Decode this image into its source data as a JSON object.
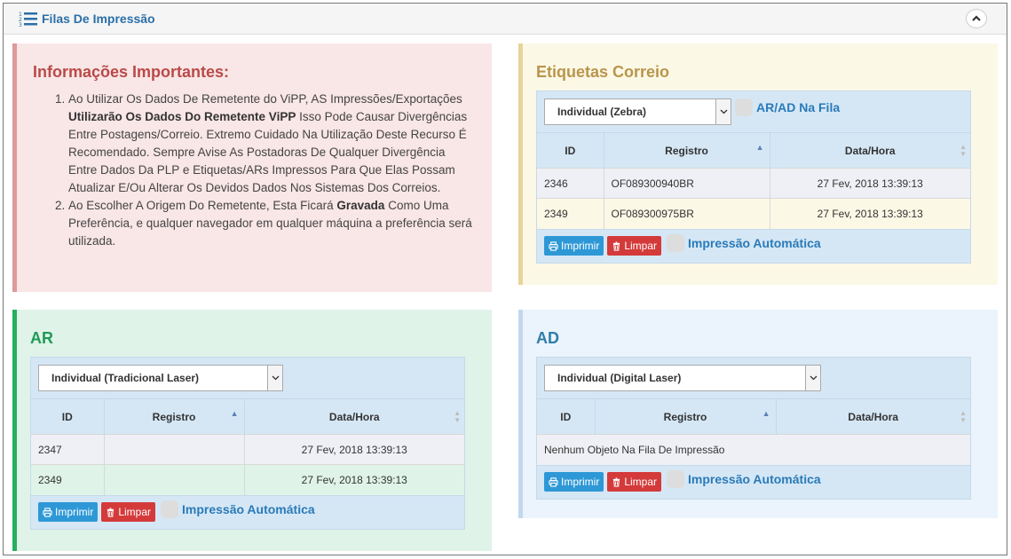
{
  "header": {
    "title": "Filas De Impressão"
  },
  "info": {
    "title": "Informações Importantes:",
    "item1_part1": "Ao Utilizar Os Dados De Remetente do ViPP, AS Impressões/Exportações ",
    "item1_bold": "Utilizarão Os Dados Do Remetente ViPP",
    "item1_part2": " Isso Pode Causar Divergências Entre Postagens/Correio. Extremo Cuidado Na Utilização Deste Recurso É Recomendado. Sempre Avise As Postadoras De Qualquer Divergência Entre Dados Da PLP e Etiquetas/ARs Impressos Para Que Elas Possam Atualizar E/Ou Alterar Os Devidos Dados Nos Sistemas Dos Correios.",
    "item2_part1": "Ao Escolher A Origem Do Remetente, Esta Ficará ",
    "item2_bold": "Gravada",
    "item2_part2": " Como Uma Preferência, e qualquer navegador em qualquer máquina a preferência será utilizada."
  },
  "columns": {
    "id": "ID",
    "registro": "Registro",
    "datahora": "Data/Hora"
  },
  "buttons": {
    "print": "Imprimir",
    "clear": "Limpar",
    "auto": "Impressão Automática"
  },
  "correio": {
    "title": "Etiquetas Correio",
    "select": "Individual (Zebra)",
    "check_label": "AR/AD Na Fila",
    "rows": [
      {
        "id": "2346",
        "registro": "OF089300940BR",
        "datahora": "27 Fev, 2018 13:39:13"
      },
      {
        "id": "2349",
        "registro": "OF089300975BR",
        "datahora": "27 Fev, 2018 13:39:13"
      }
    ]
  },
  "ar": {
    "title": "AR",
    "select": "Individual (Tradicional Laser)",
    "rows": [
      {
        "id": "2347",
        "registro": "",
        "datahora": "27 Fev, 2018 13:39:13"
      },
      {
        "id": "2349",
        "registro": "",
        "datahora": "27 Fev, 2018 13:39:13"
      }
    ]
  },
  "ad": {
    "title": "AD",
    "select": "Individual (Digital Laser)",
    "empty": "Nenhum Objeto Na Fila De Impressão"
  }
}
